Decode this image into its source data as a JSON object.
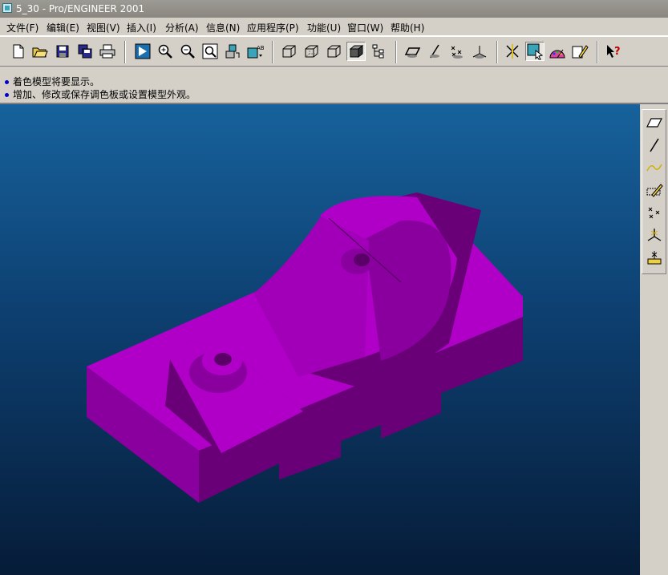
{
  "window": {
    "title": "5_30 - Pro/ENGINEER 2001"
  },
  "menu": [
    {
      "label": "文件(F)"
    },
    {
      "label": "编辑(E)"
    },
    {
      "label": "视图(V)"
    },
    {
      "label": "插入(I)"
    },
    {
      "label": "分析(A)"
    },
    {
      "label": "信息(N)"
    },
    {
      "label": "应用程序(P)"
    },
    {
      "label": "功能(U)"
    },
    {
      "label": "窗口(W)"
    },
    {
      "label": "帮助(H)"
    }
  ],
  "messages": [
    "着色模型将要显示。",
    "增加、修改或保存调色板或设置模型外观。"
  ],
  "colors": {
    "model": "#b000c8",
    "model_shade": "#8a009e",
    "model_dark": "#6a0078",
    "viewport_top": "#17629c",
    "viewport_bottom": "#061c38"
  }
}
